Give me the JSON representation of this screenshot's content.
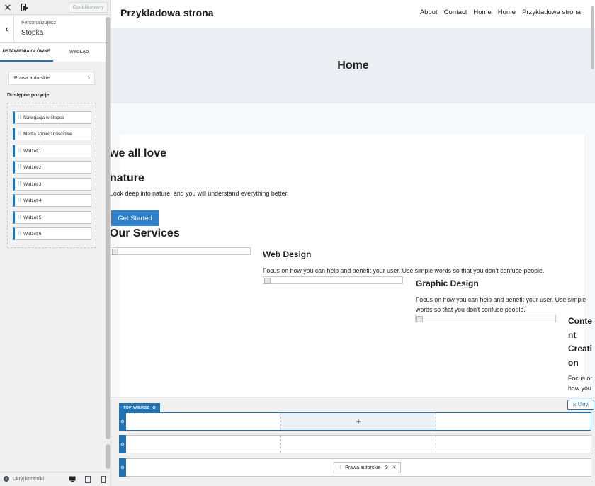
{
  "customizer": {
    "close_icon": "close-icon",
    "theme_icon": "theme-switch-icon",
    "publish_label": "Opublikowany",
    "section": {
      "subtitle": "Personalizujesz",
      "title": "Stopka",
      "back_icon": "chevron-left-icon"
    },
    "tabs": [
      {
        "label": "USTAWIENIA GŁÓWNE",
        "active": true
      },
      {
        "label": "WYGLĄD",
        "active": false
      }
    ],
    "copyright_button": "Prawa autorskie",
    "available_label": "Dostępne pozycje",
    "available_items": [
      "Nawigacja w stopce",
      "Media społecznościowe",
      "Widżet 1",
      "Widżet 2",
      "Widżet 3",
      "Widżet 4",
      "Widżet 5",
      "Widżet 6"
    ],
    "hide_controls": "Ukryj kontrolki",
    "devices": [
      "desktop-icon",
      "tablet-icon",
      "mobile-icon"
    ],
    "accent": "#2271b1"
  },
  "preview": {
    "site_title": "Przykladowa strona",
    "nav": [
      "About",
      "Contact",
      "Home",
      "Home",
      "Przykladowa strona"
    ],
    "page_title": "Home",
    "hero_line1": "we all love",
    "hero_line2": "nature",
    "hero_text": "Look deep into nature, and you will understand everything better.",
    "cta": "Get Started",
    "services_heading": "Our Services",
    "services": [
      {
        "title": "Web Design",
        "text": "Focus on how you can help and benefit your user. Use simple words so that you don't confuse people."
      },
      {
        "title": "Graphic Design",
        "text_line1": "Focus on how you can help and benefit your user. Use simple",
        "text_line2": "words so that you don't confuse people."
      },
      {
        "title_lines": [
          "Conte",
          "nt",
          "Creati",
          "on"
        ],
        "text_lines": [
          "Focus or",
          "how you"
        ]
      }
    ],
    "cta_color": "#2f80cb",
    "hero_bg": "#ebeef2"
  },
  "builder": {
    "row_label": "TOP WIERSZ",
    "hide_label": "Ukryj",
    "add_symbol": "+",
    "copyright_chip": "Prawa autorskie"
  }
}
